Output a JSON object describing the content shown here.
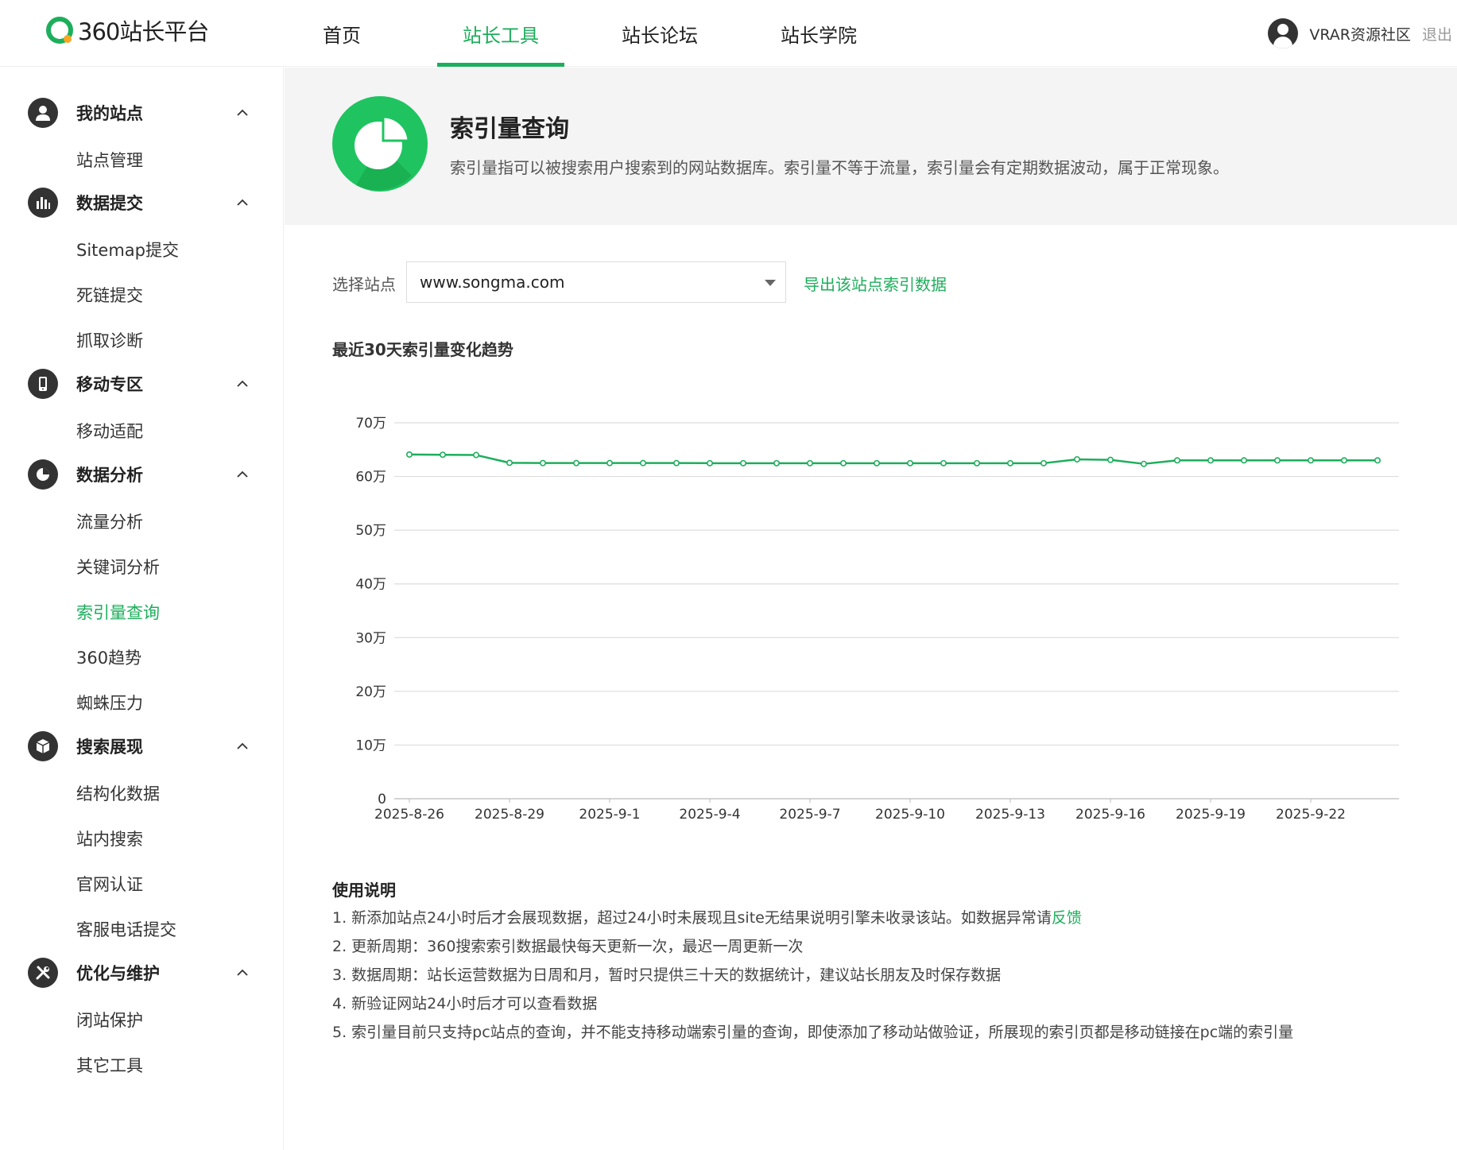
{
  "header": {
    "logo_text": "360站长平台",
    "nav": [
      {
        "label": "首页",
        "active": false
      },
      {
        "label": "站长工具",
        "active": true
      },
      {
        "label": "站长论坛",
        "active": false
      },
      {
        "label": "站长学院",
        "active": false
      }
    ],
    "user_name": "VRAR资源社区",
    "logout_label": "退出"
  },
  "sidebar": {
    "groups": [
      {
        "title": "我的站点",
        "icon": "user-icon",
        "items": [
          "站点管理"
        ]
      },
      {
        "title": "数据提交",
        "icon": "bar-chart-icon",
        "items": [
          "Sitemap提交",
          "死链提交",
          "抓取诊断"
        ]
      },
      {
        "title": "移动专区",
        "icon": "mobile-icon",
        "items": [
          "移动适配"
        ]
      },
      {
        "title": "数据分析",
        "icon": "pie-chart-icon",
        "items": [
          "流量分析",
          "关键词分析",
          "索引量查询",
          "360趋势",
          "蜘蛛压力"
        ]
      },
      {
        "title": "搜索展现",
        "icon": "cube-icon",
        "items": [
          "结构化数据",
          "站内搜索",
          "官网认证",
          "客服电话提交"
        ]
      },
      {
        "title": "优化与维护",
        "icon": "tools-icon",
        "items": [
          "闭站保护",
          "其它工具"
        ]
      }
    ],
    "active_item": "索引量查询"
  },
  "banner": {
    "title": "索引量查询",
    "description": "索引量指可以被搜索用户搜索到的网站数据库。索引量不等于流量，索引量会有定期数据波动，属于正常现象。",
    "icon": "pie-chart-icon"
  },
  "selector": {
    "label": "选择站点",
    "value": "www.songma.com",
    "export_label": "导出该站点索引数据"
  },
  "chart_title": "最近30天索引量变化趋势",
  "chart_data": {
    "type": "line",
    "title": "最近30天索引量变化趋势",
    "xlabel": "",
    "ylabel": "",
    "ylim": [
      0,
      700000
    ],
    "yticks": [
      "0",
      "10万",
      "20万",
      "30万",
      "40万",
      "50万",
      "60万",
      "70万"
    ],
    "xtick_labels": [
      "2025-8-26",
      "2025-8-29",
      "2025-9-1",
      "2025-9-4",
      "2025-9-7",
      "2025-9-10",
      "2025-9-13",
      "2025-9-16",
      "2025-9-19",
      "2025-9-22"
    ],
    "x": [
      "2025-8-26",
      "2025-8-27",
      "2025-8-28",
      "2025-8-29",
      "2025-8-30",
      "2025-8-31",
      "2025-9-1",
      "2025-9-2",
      "2025-9-3",
      "2025-9-4",
      "2025-9-5",
      "2025-9-6",
      "2025-9-7",
      "2025-9-8",
      "2025-9-9",
      "2025-9-10",
      "2025-9-11",
      "2025-9-12",
      "2025-9-13",
      "2025-9-14",
      "2025-9-15",
      "2025-9-16",
      "2025-9-17",
      "2025-9-18",
      "2025-9-19",
      "2025-9-20",
      "2025-9-21",
      "2025-9-22",
      "2025-9-23",
      "2025-9-24"
    ],
    "series": [
      {
        "values": [
          641000,
          640500,
          640000,
          625500,
          625000,
          625000,
          625000,
          625000,
          625000,
          624800,
          624800,
          624800,
          624800,
          624800,
          624800,
          624800,
          624800,
          624800,
          624800,
          624800,
          632000,
          631000,
          623500,
          630000,
          630000,
          630000,
          630000,
          630000,
          630000,
          630000
        ]
      }
    ],
    "grid": true,
    "line_color": "#1dae5c"
  },
  "notes": {
    "title": "使用说明",
    "lines": [
      {
        "text": "1.  新添加站点24小时后才会展现数据，超过24小时未展现且site无结果说明引擎未收录该站。如数据异常请",
        "link": "反馈"
      },
      {
        "text": "2.  更新周期：360搜索索引数据最快每天更新一次，最迟一周更新一次",
        "link": ""
      },
      {
        "text": "3.  数据周期：站长运营数据为日周和月，暂时只提供三十天的数据统计，建议站长朋友及时保存数据",
        "link": ""
      },
      {
        "text": "4.  新验证网站24小时后才可以查看数据",
        "link": ""
      },
      {
        "text": "5.  索引量目前只支持pc站点的查询，并不能支持移动端索引量的查询，即使添加了移动站做验证，所展现的索引页都是移动链接在pc端的索引量",
        "link": ""
      }
    ]
  },
  "colors": {
    "accent": "#1dae5c",
    "banner_bg": "#f4f4f4",
    "icon_dark": "#333333"
  }
}
